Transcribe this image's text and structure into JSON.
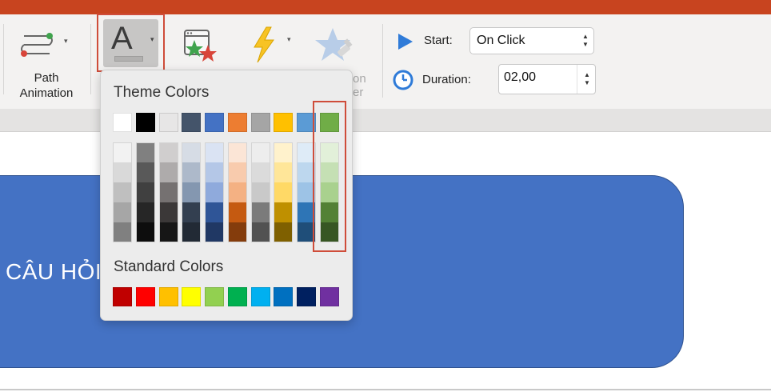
{
  "ribbon": {
    "path_animation_label_line1": "Path",
    "path_animation_label_line2": "Animation",
    "font_color_letter": "A",
    "ghost_label_1": "on",
    "ghost_label_2": "er",
    "start_label": "Start:",
    "start_value": "On Click",
    "duration_label": "Duration:",
    "duration_value": "02,00"
  },
  "slide": {
    "shape_text": "CÂU HỎI"
  },
  "palette": {
    "theme_title": "Theme Colors",
    "standard_title": "Standard Colors",
    "theme_colors": [
      "#ffffff",
      "#000000",
      "#e7e6e6",
      "#44546a",
      "#4472c4",
      "#ed7d31",
      "#a5a5a5",
      "#ffc000",
      "#5b9bd5",
      "#70ad47"
    ],
    "shades": [
      [
        "#f2f2f2",
        "#d9d9d9",
        "#bfbfbf",
        "#a6a6a6",
        "#808080"
      ],
      [
        "#808080",
        "#595959",
        "#404040",
        "#262626",
        "#0d0d0d"
      ],
      [
        "#d0cece",
        "#aeabab",
        "#757171",
        "#3b3838",
        "#161616"
      ],
      [
        "#d6dce5",
        "#adb9ca",
        "#8497b0",
        "#333f50",
        "#222a35"
      ],
      [
        "#dae3f3",
        "#b4c7e7",
        "#8faadc",
        "#2f5597",
        "#203864"
      ],
      [
        "#fbe5d6",
        "#f8cbad",
        "#f4b183",
        "#c55a11",
        "#843c0c"
      ],
      [
        "#ededed",
        "#dbdbdb",
        "#c9c9c9",
        "#7b7b7b",
        "#525252"
      ],
      [
        "#fff2cc",
        "#ffe699",
        "#ffd966",
        "#bf9000",
        "#7f6000"
      ],
      [
        "#deebf7",
        "#bdd7ee",
        "#9dc3e6",
        "#2e75b6",
        "#1f4e79"
      ],
      [
        "#e2f0d9",
        "#c5e0b4",
        "#a9d18e",
        "#538135",
        "#375623"
      ]
    ],
    "standard_colors": [
      "#c00000",
      "#ff0000",
      "#ffc000",
      "#ffff00",
      "#92d050",
      "#00b050",
      "#00b0f0",
      "#0070c0",
      "#002060",
      "#7030a0"
    ]
  },
  "colors": {
    "title_bar": "#c8441f",
    "shape_fill": "#4472c4",
    "highlight_border": "#cf4d3a"
  }
}
